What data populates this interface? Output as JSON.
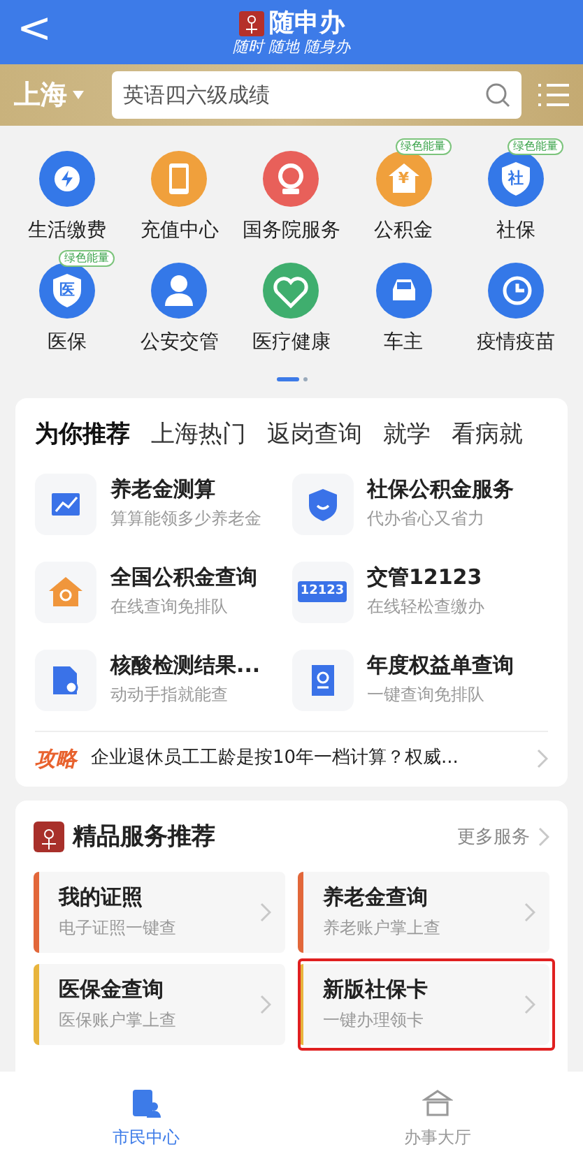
{
  "header": {
    "back": "<",
    "app_name": "随申办",
    "tagline": "随时 随地 随身办"
  },
  "search_bar": {
    "city": "上海",
    "placeholder": "英语四六级成绩"
  },
  "grid": [
    {
      "label": "生活缴费",
      "color": "#3478e8",
      "kind": "bolt"
    },
    {
      "label": "充值中心",
      "color": "#f0a03c",
      "kind": "phone"
    },
    {
      "label": "国务院服务",
      "color": "#e8605a",
      "kind": "emblem"
    },
    {
      "label": "公积金",
      "color": "#f0a03c",
      "kind": "house",
      "badge": "绿色能量"
    },
    {
      "label": "社保",
      "color": "#3478e8",
      "kind": "shield",
      "badge": "绿色能量"
    },
    {
      "label": "医保",
      "color": "#3478e8",
      "kind": "shield",
      "badge": "绿色能量"
    },
    {
      "label": "公安交管",
      "color": "#3478e8",
      "kind": "police"
    },
    {
      "label": "医疗健康",
      "color": "#3fae6e",
      "kind": "heart"
    },
    {
      "label": "车主",
      "color": "#3478e8",
      "kind": "car"
    },
    {
      "label": "疫情疫苗",
      "color": "#3478e8",
      "kind": "clock"
    }
  ],
  "grid_glyphs": {
    "3": "¥",
    "4": "社",
    "5": "医"
  },
  "tabs": [
    {
      "label": "为你推荐",
      "selected": true
    },
    {
      "label": "上海热门",
      "selected": false
    },
    {
      "label": "返岗查询",
      "selected": false
    },
    {
      "label": "就学",
      "selected": false
    },
    {
      "label": "看病就",
      "selected": false
    }
  ],
  "recommend": [
    {
      "title": "养老金测算",
      "subtitle": "算算能领多少养老金",
      "kind": "chart"
    },
    {
      "title": "社保公积金服务",
      "subtitle": "代办省心又省力",
      "kind": "shield"
    },
    {
      "title": "全国公积金查询",
      "subtitle": "在线查询免排队",
      "kind": "house"
    },
    {
      "title": "交管12123",
      "subtitle": "在线轻松查缴办",
      "kind": "card",
      "icon_text": "12123"
    },
    {
      "title": "核酸检测结果...",
      "subtitle": "动动手指就能查",
      "kind": "flask"
    },
    {
      "title": "年度权益单查询",
      "subtitle": "一键查询免排队",
      "kind": "receipt"
    }
  ],
  "tip": {
    "tag": "攻略",
    "text": "企业退休员工工龄是按10年一档计算？权威..."
  },
  "premium": {
    "title": "精品服务推荐",
    "more": "更多服务",
    "items": [
      {
        "title": "我的证照",
        "subtitle": "电子证照一键查",
        "color": "#e2673a",
        "highlighted": false
      },
      {
        "title": "养老金查询",
        "subtitle": "养老账户掌上查",
        "color": "#e2673a",
        "highlighted": false
      },
      {
        "title": "医保金查询",
        "subtitle": "医保账户掌上查",
        "color": "#e8b43c",
        "highlighted": false
      },
      {
        "title": "新版社保卡",
        "subtitle": "一键办理领卡",
        "color": "#e8b43c",
        "highlighted": true
      }
    ]
  },
  "bottom_nav": [
    {
      "label": "市民中心",
      "selected": true
    },
    {
      "label": "办事大厅",
      "selected": false
    }
  ]
}
